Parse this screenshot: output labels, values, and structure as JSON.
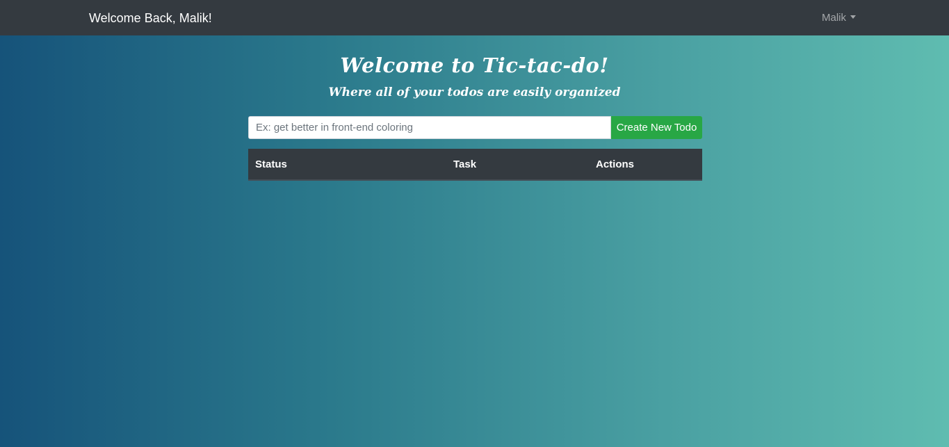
{
  "navbar": {
    "brand": "Welcome Back, Malik!",
    "user_menu_label": "Malik",
    "user_menu_icon": "caret-down-icon"
  },
  "hero": {
    "title": "Welcome to Tic-tac-do!",
    "subtitle": "Where all of your todos are easily organized"
  },
  "todo_form": {
    "input_value": "",
    "input_placeholder": "Ex: get better in front-end coloring",
    "create_button_label": "Create New Todo"
  },
  "todo_table": {
    "columns": [
      "Status",
      "Task",
      "Actions"
    ],
    "rows": []
  },
  "colors": {
    "navbar_bg": "#343a40",
    "create_button_bg": "#28a745",
    "gradient_start": "#16537a",
    "gradient_end": "#5fbcb0"
  }
}
